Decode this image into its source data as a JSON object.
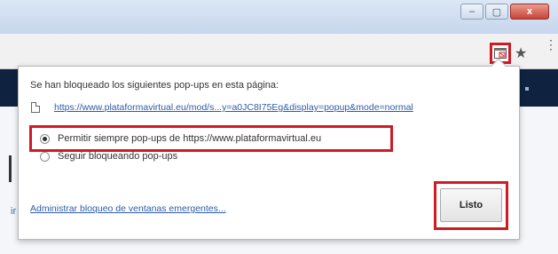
{
  "window": {
    "minimize_label": "–",
    "maximize_label": "▢",
    "close_label": "x"
  },
  "toolbar": {
    "popup_blocked_icon": "popup-blocked-icon",
    "star_icon": "★",
    "menu_icon": "⋮"
  },
  "bubble": {
    "heading": "Se han bloqueado los siguientes pop-ups en esta página:",
    "popup_url": "https://www.plataformavirtual.eu/mod/s...y=a0JC8I75Eg&display=popup&mode=normal",
    "options": [
      {
        "label": "Permitir siempre pop-ups de https://www.plataformavirtual.eu",
        "checked": true
      },
      {
        "label": "Seguir bloqueando pop-ups",
        "checked": false
      }
    ],
    "manage_link": "Administrar bloqueo de ventanas emergentes...",
    "done_label": "Listo"
  },
  "page": {
    "side_mark": "ir"
  },
  "colors": {
    "highlight": "#d01a24",
    "nav_bg": "#0f2340",
    "link": "#2d5ba8"
  }
}
